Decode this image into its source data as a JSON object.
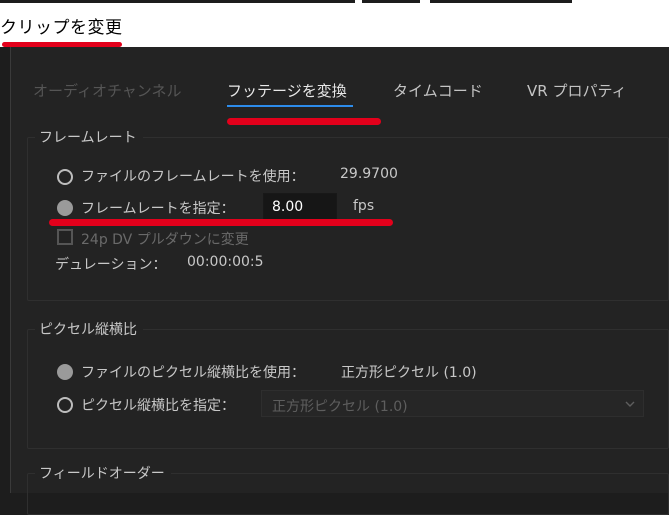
{
  "window": {
    "title": "クリップを変更"
  },
  "tabs": [
    {
      "label": "オーディオチャンネル",
      "state": "disabled"
    },
    {
      "label": "フッテージを変換",
      "state": "active"
    },
    {
      "label": "タイムコード",
      "state": "normal"
    },
    {
      "label": "VR プロパティ",
      "state": "normal"
    }
  ],
  "frame_rate": {
    "legend": "フレームレート",
    "use_file_label": "ファイルのフレームレートを使用：",
    "file_value": "29.9700",
    "assume_label": "フレームレートを指定：",
    "assume_value": "8.00",
    "unit": "fps",
    "pulldown_label": "24p DV プルダウンに変更",
    "duration_label": "デュレーション：",
    "duration_value": "00:00:00:5"
  },
  "pixel_aspect": {
    "legend": "ピクセル縦横比",
    "use_file_label": "ファイルのピクセル縦横比を使用：",
    "file_value": "正方形ピクセル (1.0)",
    "conform_label": "ピクセル縦横比を指定：",
    "conform_value": "正方形ピクセル (1.0)"
  },
  "field_order": {
    "legend": "フィールドオーダー"
  },
  "colors": {
    "annotation_red": "#e3001b",
    "tab_underline": "#2d8ceb",
    "dialog_bg": "#232323"
  }
}
